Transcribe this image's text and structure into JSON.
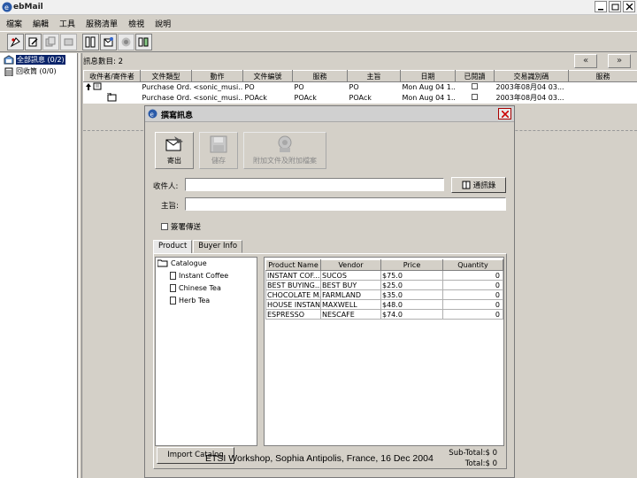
{
  "app": {
    "title": "ebMail",
    "menu": [
      "檔案",
      "編輯",
      "工具",
      "服務清單",
      "檢視",
      "說明"
    ]
  },
  "colors": {
    "selection": "#0a246a",
    "close_accent": "#cc0000",
    "icon_blue": "#2a5aa8"
  },
  "toolbar_icons": [
    "new-mail-icon",
    "compose-icon",
    "copy-icon",
    "delete-icon",
    "print-icon",
    "reply-icon",
    "forward-icon",
    "send-receive-icon"
  ],
  "tree": {
    "items": [
      {
        "label": "全部訊息 (0/2)",
        "icon": "inbox-icon"
      },
      {
        "label": "回收筒 (0/0)",
        "icon": "trash-icon"
      }
    ]
  },
  "message_list": {
    "count_label": "訊息數目: 2",
    "prev_label": "«",
    "next_label": "»",
    "columns": [
      "收件者/寄件者",
      "文件類型",
      "動作",
      "文件編號",
      "服務",
      "主旨",
      "日期",
      "已閱讀",
      "交易識別碼",
      "服務"
    ],
    "rows": [
      [
        "Purchase Ord...",
        "<sonic_musi...",
        "PO",
        "PO",
        "PO",
        "Mon Aug 04 1...",
        "",
        "2003年08月04 03..."
      ],
      [
        "Purchase Ord...",
        "<sonic_musi...",
        "POAck",
        "POAck",
        "POAck",
        "Mon Aug 04 1...",
        "",
        "2003年08月04 03..."
      ]
    ]
  },
  "dialog": {
    "title": "撰寫訊息",
    "send_label": "寄出",
    "save_label": "儲存",
    "attach_label": "附加文件及附加檔案",
    "recipient_label": "收件人:",
    "recipient_value": "",
    "subject_label": "主旨:",
    "subject_value": "",
    "addressbook_label": "通訊錄",
    "checkbox_label": "簽署傳送",
    "tabs": [
      "Product",
      "Buyer Info"
    ],
    "catalog_root": "Catalogue",
    "catalog_items": [
      "Instant Coffee",
      "Chinese Tea",
      "Herb Tea"
    ],
    "product_columns": [
      "Product Name",
      "Vendor",
      "Price",
      "Quantity"
    ],
    "products": [
      [
        "INSTANT COF...",
        "SUCOS",
        "$75.0",
        "0"
      ],
      [
        "BEST BUYING...",
        "BEST BUY",
        "$25.0",
        "0"
      ],
      [
        "CHOCOLATE M...",
        "FARMLAND",
        "$35.0",
        "0"
      ],
      [
        "HOUSE INSTAN...",
        "MAXWELL",
        "$48.0",
        "0"
      ],
      [
        "ESPRESSO",
        "NESCAFE",
        "$74.0",
        "0"
      ]
    ],
    "import_label": "Import Catalog",
    "subtotal": "Sub-Total:$ 0",
    "total": "Total:$ 0"
  },
  "footer": "ETSI Workshop, Sophia Antipolis, France, 16 Dec 2004"
}
